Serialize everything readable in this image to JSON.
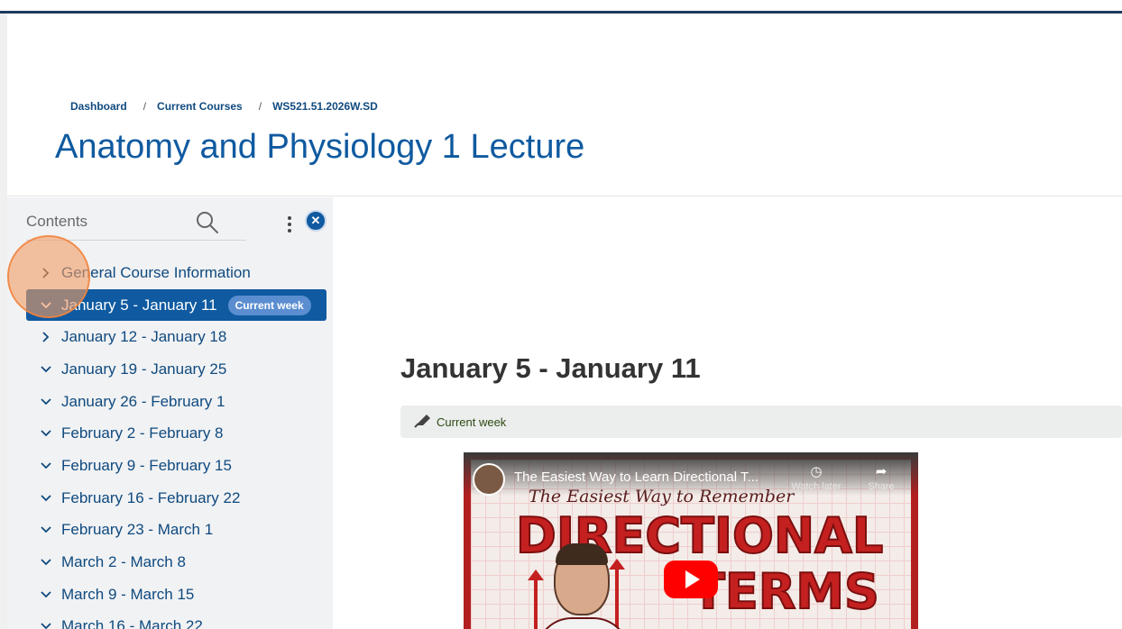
{
  "breadcrumb": {
    "items": [
      "Dashboard",
      "Current Courses",
      "WS521.51.2026W.SD"
    ],
    "separator": "/"
  },
  "page_title": "Anatomy and Physiology 1 Lecture",
  "sidebar": {
    "label": "Contents",
    "close_icon": "close-icon",
    "search_icon": "search-icon",
    "menu_icon": "kebab-icon",
    "items": [
      {
        "label": "General Course Information",
        "expanded": false,
        "active": false
      },
      {
        "label": "January 5 - January 11",
        "expanded": true,
        "active": true,
        "badge": "Current week"
      },
      {
        "label": "January 12 - January 18",
        "expanded": false,
        "active": false
      },
      {
        "label": "January 19 - January 25",
        "expanded": true,
        "active": false
      },
      {
        "label": "January 26 - February 1",
        "expanded": true,
        "active": false
      },
      {
        "label": "February 2 - February 8",
        "expanded": true,
        "active": false
      },
      {
        "label": "February 9 - February 15",
        "expanded": true,
        "active": false
      },
      {
        "label": "February 16 - February 22",
        "expanded": true,
        "active": false
      },
      {
        "label": "February 23 - March 1",
        "expanded": true,
        "active": false
      },
      {
        "label": "March 2 - March 8",
        "expanded": true,
        "active": false
      },
      {
        "label": "March 9 - March 15",
        "expanded": true,
        "active": false
      },
      {
        "label": "March 16 - March 22",
        "expanded": true,
        "active": false
      }
    ]
  },
  "main": {
    "section_title": "January 5 - January 11",
    "week_label": "Current week",
    "video": {
      "title": "The Easiest Way to Learn Directional T...",
      "watch_later": "Watch later",
      "share": "Share",
      "thumb_script": "The Easiest Way to Remember",
      "thumb_word_1": "DIRECTIONAL",
      "thumb_word_2": "TERMS"
    }
  },
  "colors": {
    "accent": "#0f5aa0",
    "badge": "#5b8ed0",
    "sidebar_bg": "#f1f2f4"
  }
}
